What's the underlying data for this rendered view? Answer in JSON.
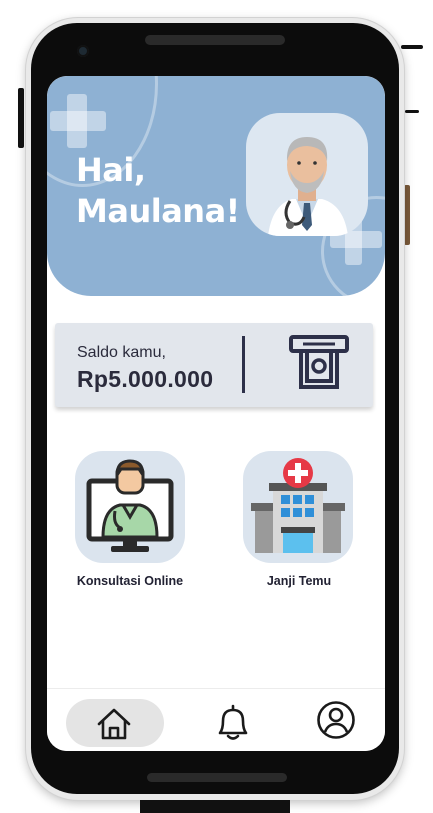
{
  "header": {
    "greeting": "Hai,",
    "user_name": "Maulana!"
  },
  "balance": {
    "label": "Saldo kamu,",
    "amount": "Rp5.000.000",
    "icon": "atm-cash-icon"
  },
  "menu": [
    {
      "label": "Konsultasi Online",
      "icon": "doctor-monitor-icon"
    },
    {
      "label": "Janji Temu",
      "icon": "hospital-building-icon"
    }
  ],
  "bottom_nav": [
    {
      "icon": "home-icon",
      "active": true
    },
    {
      "icon": "bell-icon",
      "active": false
    },
    {
      "icon": "profile-icon",
      "active": false
    }
  ],
  "colors": {
    "hero_bg": "#8eb1d3",
    "card_bg": "#e2e6ec",
    "tile_bg": "#dbe4ee",
    "text_dark": "#2b2b3c",
    "accent_red": "#e63946"
  }
}
